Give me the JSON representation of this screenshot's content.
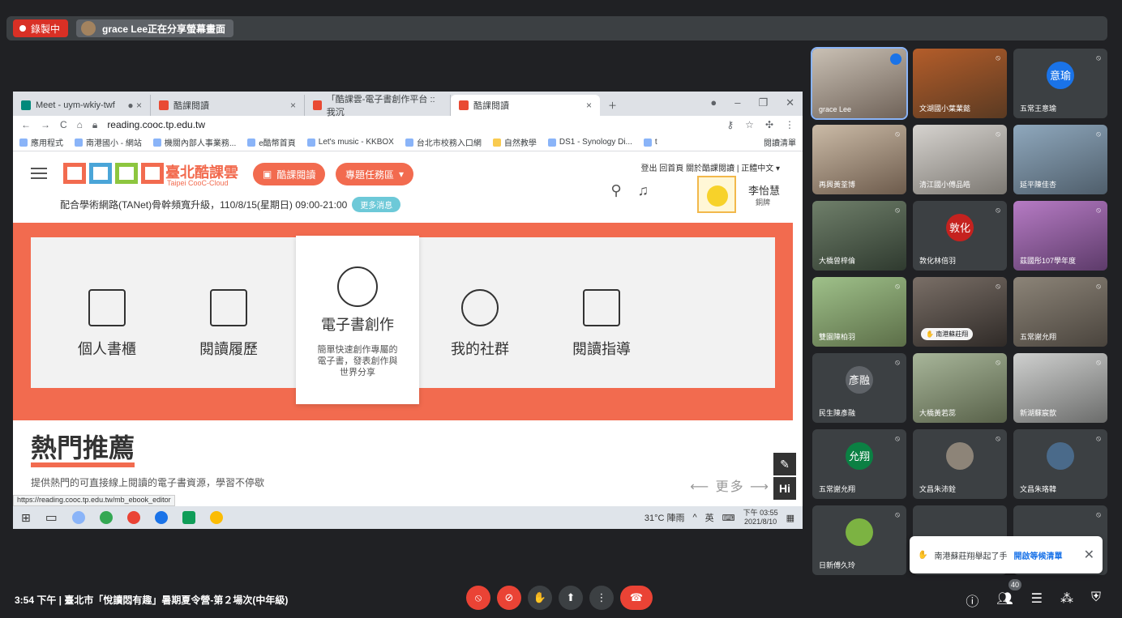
{
  "banner": {
    "recording_label": "錄製中",
    "sharing_label": "grace Lee正在分享螢幕畫面"
  },
  "browser": {
    "tabs": [
      {
        "label": "Meet - uym-wkiy-twf"
      },
      {
        "label": "酷課閱讀"
      },
      {
        "label": "「酷課雲-電子書創作平台 :: 我沉"
      },
      {
        "label": "酷課閱讀"
      }
    ],
    "url": "reading.cooc.tp.edu.tw",
    "bookmarks": [
      "應用程式",
      "南港國小 - 網站",
      "機關內部人事業務...",
      "e酷幣首頁",
      "Let's music - KKBOX",
      "台北市校務入口網",
      "自然教學",
      "DS1 - Synology Di...",
      "t"
    ],
    "reading_list": "閱讀清單"
  },
  "site": {
    "logo_text": "臺北酷課雲",
    "logo_sub": "Taipei CooC-Cloud",
    "btn_reading": "酷課閱讀",
    "btn_topic": "專題任務區",
    "announcement": "配合學術網路(TANet)骨幹頻寬升級，110/8/15(星期日) 09:00-21:00",
    "more_news": "更多消息",
    "top_links": "登出  回首頁  關於酷課閱讀  |  正體中文 ▾",
    "user_name": "李怡慧",
    "user_role": "銅牌",
    "nav": [
      {
        "label": "個人書櫃"
      },
      {
        "label": "閱讀履歷"
      },
      {
        "label": "我的社群"
      },
      {
        "label": "閱讀指導"
      }
    ],
    "feature": {
      "title": "電子書創作",
      "desc": "簡單快速創作專屬的電子書，發表創作與世界分享"
    },
    "hot_title": "熱門推薦",
    "hot_sub": "提供熱門的可直接線上閱讀的電子書資源，學習不停歇",
    "more": "⟵ 更多 ⟶",
    "hi_label": "Hi",
    "status_url": "https://reading.cooc.tp.edu.tw/mb_ebook_editor"
  },
  "taskbar": {
    "weather": "31°C 陣雨",
    "ime": "英",
    "time": "下午 03:55",
    "date": "2021/8/10"
  },
  "participants": [
    {
      "name": "grace Lee"
    },
    {
      "name": "文湖國小葉業懿"
    },
    {
      "name": "五常王意瑜",
      "initial": "意瑜",
      "color": "#1a73e8"
    },
    {
      "name": "再興黃荃博"
    },
    {
      "name": "清江國小傅品皓"
    },
    {
      "name": "延平陳佳杏"
    },
    {
      "name": "大橋曾梓倫"
    },
    {
      "name": "敦化林倍羽",
      "initial": "敦化",
      "color": "#c5221f"
    },
    {
      "name": "茲國彤107學年度"
    },
    {
      "name": "雙園陳柏羽"
    },
    {
      "name": "南港蘇莊翔"
    },
    {
      "name": "五常謝允翔"
    },
    {
      "name": "民生陳彥融",
      "initial": "彥融",
      "color": "#5f6368"
    },
    {
      "name": "大橋黃若蕊"
    },
    {
      "name": "新湖蘇宸歆"
    },
    {
      "name": "五常謝允翔",
      "initial": "允翔",
      "color": "#0b8043"
    },
    {
      "name": "文昌朱沛銓"
    },
    {
      "name": "文昌朱珞韓"
    },
    {
      "name": "日新傅久玲"
    }
  ],
  "toast": {
    "text": "南港蘇莊翔舉起了手",
    "link": "開啟等候清單"
  },
  "meeting": {
    "info": "3:54 下午  |  臺北市「悅讀悶有趣」暑期夏令營-第２場次(中年級)",
    "participant_count": "40"
  }
}
